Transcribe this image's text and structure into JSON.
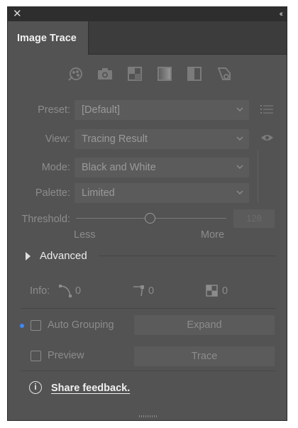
{
  "window": {
    "close_icon": "close-icon",
    "collapse_icon": "double-chevron-left-icon"
  },
  "tab": {
    "label": "Image Trace"
  },
  "preset_icons": [
    "auto-color-icon",
    "high-color-icon",
    "low-color-icon",
    "grayscale-icon",
    "black-and-white-icon",
    "outline-icon"
  ],
  "fields": {
    "preset": {
      "label": "Preset:",
      "value": "[Default]"
    },
    "view": {
      "label": "View:",
      "value": "Tracing Result"
    },
    "mode": {
      "label": "Mode:",
      "value": "Black and White"
    },
    "palette": {
      "label": "Palette:",
      "value": "Limited"
    }
  },
  "threshold": {
    "label": "Threshold:",
    "value": "128",
    "level": 0.5,
    "min_label": "Less",
    "max_label": "More"
  },
  "advanced": {
    "label": "Advanced"
  },
  "info": {
    "label": "Info:",
    "paths": "0",
    "anchors": "0",
    "colors": "0"
  },
  "auto_grouping": {
    "label": "Auto Grouping",
    "checked": false
  },
  "preview": {
    "label": "Preview",
    "checked": false
  },
  "buttons": {
    "expand": "Expand",
    "trace": "Trace"
  },
  "feedback": {
    "label": "Share feedback.",
    "icon": "info-icon"
  },
  "colors": {
    "panel": "#535353",
    "accent_dot": "#3d87f5"
  }
}
